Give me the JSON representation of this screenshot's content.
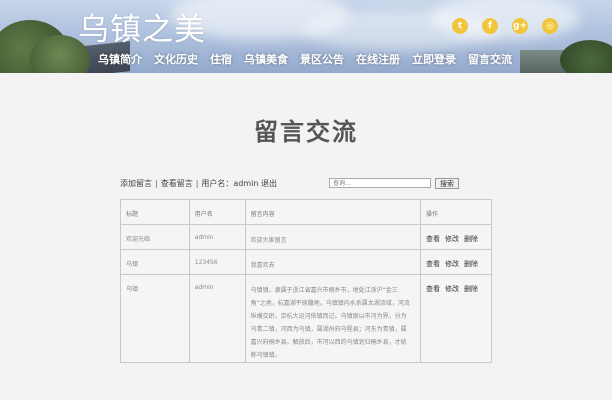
{
  "site": {
    "title": "乌镇之美"
  },
  "social": [
    {
      "icon": "twitter-icon",
      "glyph": "t"
    },
    {
      "icon": "facebook-icon",
      "glyph": "f"
    },
    {
      "icon": "google-plus-icon",
      "glyph": "g+"
    },
    {
      "icon": "dribbble-icon",
      "glyph": "◎"
    }
  ],
  "nav": [
    "乌镇简介",
    "文化历史",
    "住宿",
    "乌镇美食",
    "景区公告",
    "在线注册",
    "立即登录",
    "留言交流"
  ],
  "page": {
    "title": "留言交流"
  },
  "toolbar": {
    "add": "添加留言",
    "view": "查看留言",
    "user_prefix": "用户名：",
    "username": "admin",
    "logout": "退出",
    "search_placeholder": "查询...",
    "search_label": "搜索"
  },
  "table": {
    "headers": [
      "标题",
      "用户名",
      "留言内容",
      "操作"
    ],
    "actions": [
      "查看",
      "修改",
      "删除"
    ],
    "rows": [
      {
        "title": "欢迎光临",
        "user": "admin",
        "content": "欢迎大家留言"
      },
      {
        "title": "乌镇",
        "user": "123456",
        "content": "我喜欢去"
      },
      {
        "title": "乌镇",
        "user": "admin",
        "content": "乌镇镇，隶属于浙江省嘉兴市桐乡市，地处江浙沪“金三角”之地，杭嘉湖平原腹地。乌镇镇内水系属太湖流域，河流纵横交织，京杭大运河依镇而过。乌镇原以市河为界，分为乌青二镇，河西为乌镇，属湖州府乌程县；河东为青镇，属嘉兴府桐乡县。解放后，市河以西的乌镇划归桐乡县，才统称乌镇镇。"
      }
    ]
  },
  "colors": {
    "social": "#f2c63b",
    "page_bg": "#f3f3f3",
    "title": "#555555"
  }
}
